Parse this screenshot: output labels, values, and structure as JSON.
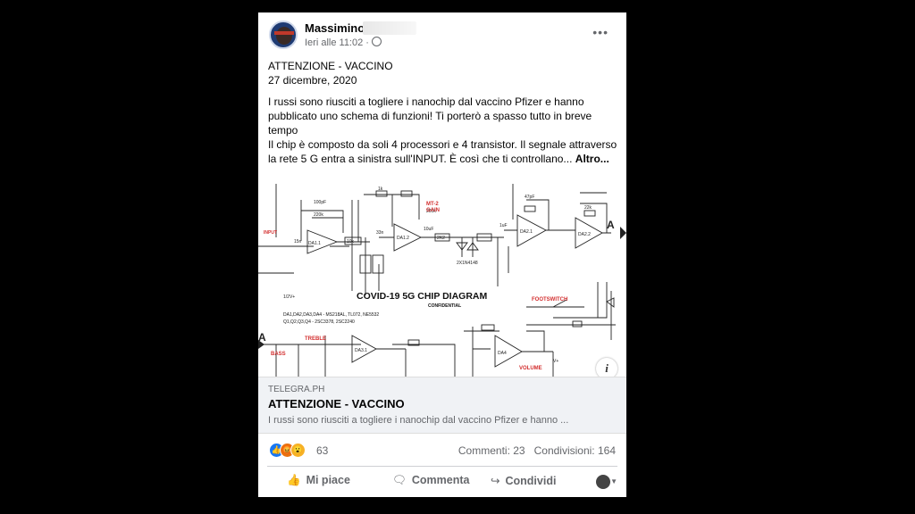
{
  "post": {
    "author": "Massimino P",
    "time": "Ieri alle 11:02 ·",
    "more_label": "•••",
    "title_line": "ATTENZIONE - VACCINO",
    "date_line": "27 dicembre, 2020",
    "paragraph1": "I russi sono riusciti a togliere i nanochip dal vaccino Pfizer e hanno pubblicato uno schema di funzioni! Ti porterò a spasso tutto in breve tempo",
    "paragraph2": "Il chip è composto da soli 4 processori e 4 transistor. Il segnale attraverso la rete 5 G entra a sinistra sull'INPUT. È così che ti controllano... ",
    "see_more": "Altro..."
  },
  "diagram": {
    "title": "COVID-19 5G CHIP DIAGRAM",
    "subtitle": "CONFIDENTIAL",
    "parts1": "DA1,DA2,DA3,DA4 - MS218AL, TL072, NE5532",
    "parts2": "Q1,Q2,Q3,Q4 - 2SC3378, 2SC2240",
    "labels": {
      "input": "INPUT",
      "gain": "MT-2",
      "gain2": "GAIN",
      "footswitch": "FOOTSWITCH",
      "treble": "TREBLE",
      "bass": "BASS",
      "volume": "VOLUME",
      "a": "A",
      "da11": "DA1.1",
      "da12": "DA1.2",
      "da21": "DA2.1",
      "da22": "DA2.2",
      "da31": "DA3.1",
      "da4": "DA4",
      "r15n": "15n",
      "r33n": "33n",
      "r10k": "10k",
      "r2k2": "2K2",
      "r100p": "100pF",
      "r220k": "220k",
      "r1k": "1k",
      "r47pf": "47pF",
      "r200k": "200k",
      "r22k": "22k",
      "r1uf": "1uF",
      "r10uf": "10uF",
      "diodes": "2X1N4148",
      "v": "V+",
      "r12v": "1/2V+"
    }
  },
  "link": {
    "domain": "TELEGRA.PH",
    "title": "ATTENZIONE - VACCINO",
    "description": "I russi sono riusciti a togliere i nanochip dal vaccino Pfizer e hanno ..."
  },
  "stats": {
    "reactions_count": "63",
    "comments": "Commenti: 23",
    "shares": "Condivisioni: 164"
  },
  "actions": {
    "like": "Mi piace",
    "comment": "Commenta",
    "share": "Condividi"
  },
  "icons": {
    "info": "i"
  },
  "colors": {
    "accent": "#1877f2",
    "diagram_red": "#d32f2f",
    "meta_text": "#65676b"
  }
}
